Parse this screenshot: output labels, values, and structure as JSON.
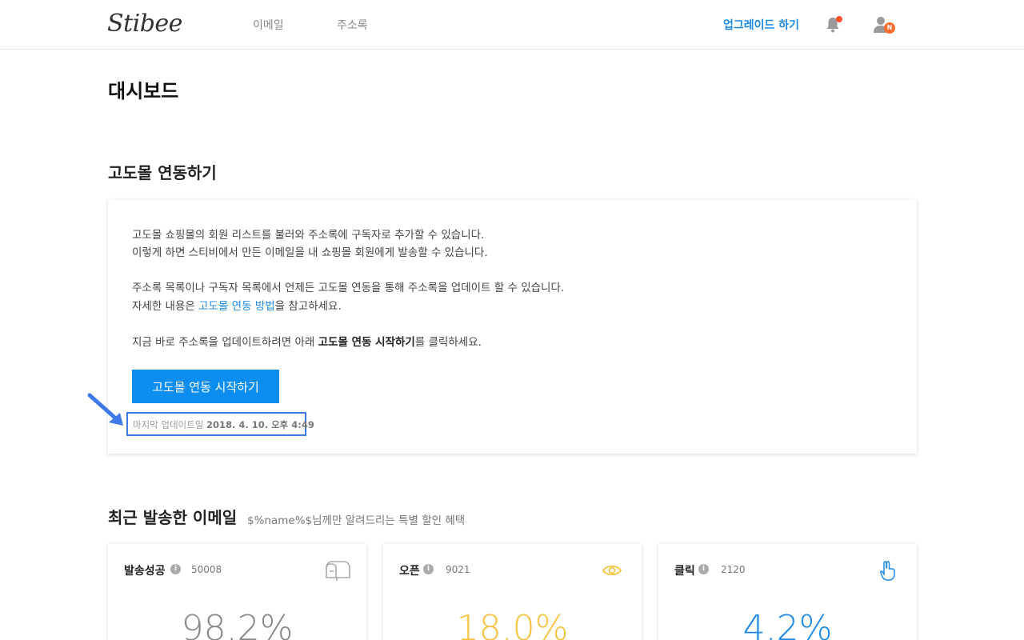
{
  "header": {
    "logo": "Stibee",
    "nav": [
      "이메일",
      "주소록"
    ],
    "upgrade_label": "업그레이드 하기",
    "user_badge": "N"
  },
  "page": {
    "title": "대시보드"
  },
  "integration": {
    "title": "고도몰 연동하기",
    "line1": "고도몰 쇼핑몰의 회원 리스트를 불러와 주소록에 구독자로 추가할 수 있습니다.",
    "line2": "이렇게 하면 스티비에서 만든 이메일을 내 쇼핑몰 회원에게 발송할 수 있습니다.",
    "line3": "주소록 목록이나 구독자 목록에서 언제든 고도몰 연동을 통해 주소록을 업데이트 할 수 있습니다.",
    "line4_prefix": "자세한 내용은 ",
    "line4_link": "고도몰 연동 방법",
    "line4_suffix": "을 참고하세요.",
    "line5_prefix": "지금 바로 주소록을 업데이트하려면 아래 ",
    "line5_bold": "고도몰 연동 시작하기",
    "line5_suffix": "를 클릭하세요.",
    "button_label": "고도몰 연동 시작하기",
    "last_updated_label": "마지막 업데이트일",
    "last_updated_value": "2018. 4. 10. 오후 4:49"
  },
  "recent": {
    "title": "최근 발송한 이메일",
    "subject": "$%name%$님께만 알려드리는 특별 할인 혜택",
    "stats": [
      {
        "label": "발송성공",
        "count": "50008",
        "value": "98.2%",
        "icon": "mailbox-icon",
        "color": "#888888"
      },
      {
        "label": "오픈",
        "count": "9021",
        "value": "18.0%",
        "icon": "eye-icon",
        "color": "#f5c340"
      },
      {
        "label": "클릭",
        "count": "2120",
        "value": "4.2%",
        "icon": "hand-pointer-icon",
        "color": "#1d8ae6"
      }
    ]
  },
  "colors": {
    "accent": "#1d8ae6",
    "button": "#0b8ef0",
    "highlight_box": "#3d79e8",
    "notification_dot": "#ff4e2a"
  }
}
